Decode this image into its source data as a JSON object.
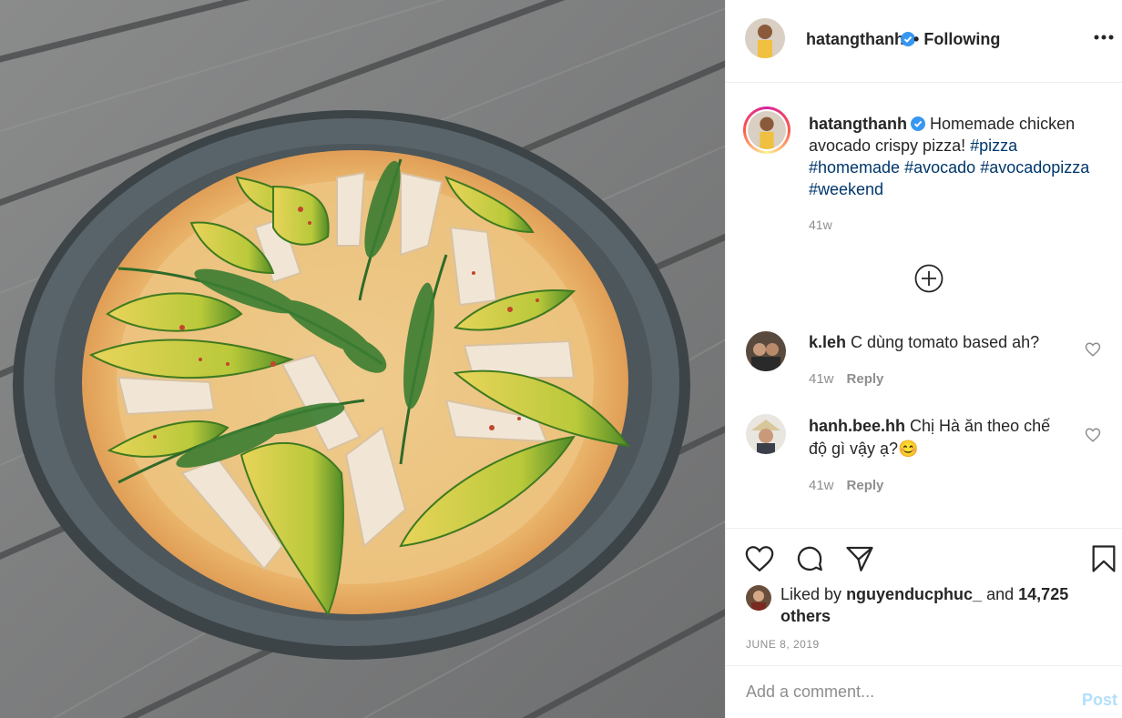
{
  "colors": {
    "link": "#00376b",
    "verified": "#3897f0",
    "muted": "#8e8e8e",
    "post_disabled": "#b2dffc"
  },
  "photo": {
    "subject": "pizza-photo"
  },
  "header": {
    "username": "hatangthanh",
    "verified_icon": "verified-badge-icon",
    "separator": "•",
    "follow_status": "Following",
    "more_icon": "more-options-icon"
  },
  "caption": {
    "username": "hatangthanh",
    "text": "Homemade chicken avocado crispy pizza!",
    "hashtags": [
      "#pizza",
      "#homemade",
      "#avocado",
      "#avocadopizza",
      "#weekend"
    ],
    "time": "41w"
  },
  "load_more_icon": "plus-circle-icon",
  "comments": [
    {
      "username": "k.leh",
      "text": "C dùng tomato based ah?",
      "time": "41w",
      "reply": "Reply"
    },
    {
      "username": "hanh.bee.hh",
      "text": "Chị Hà ăn theo chế độ gì vậy ạ?😊",
      "time": "41w",
      "reply": "Reply"
    }
  ],
  "actions": {
    "like_icon": "heart-icon",
    "comment_icon": "comment-icon",
    "share_icon": "share-icon",
    "save_icon": "bookmark-icon"
  },
  "likes": {
    "prefix": "Liked by",
    "user": "nguyenducphuc_",
    "and": "and",
    "others": "14,725 others"
  },
  "date": "JUNE 8, 2019",
  "add_comment": {
    "placeholder": "Add a comment...",
    "post_label": "Post"
  }
}
